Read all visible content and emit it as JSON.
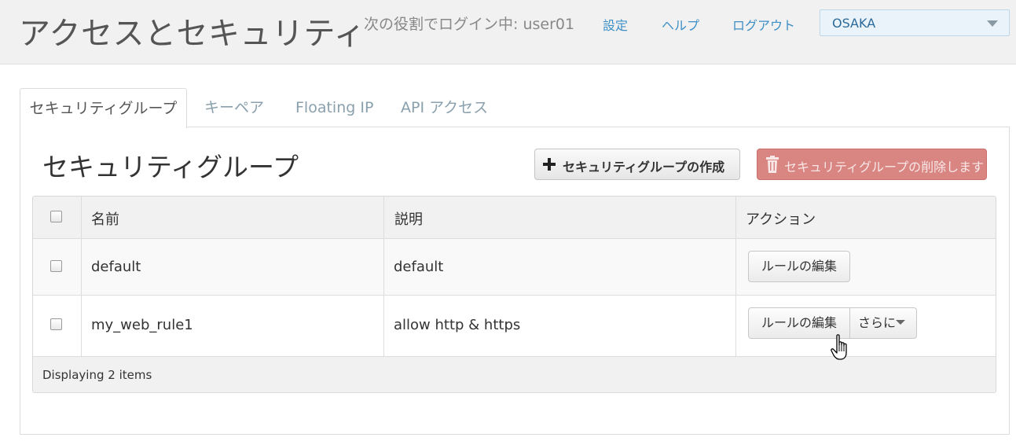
{
  "header": {
    "title": "アクセスとセキュリティ",
    "login_info": "次の役割でログイン中: user01",
    "links": {
      "settings": "設定",
      "help": "ヘルプ",
      "logout": "ログアウト"
    },
    "region": {
      "selected": "OSAKA"
    }
  },
  "tabs": [
    {
      "label": "セキュリティグループ",
      "active": true
    },
    {
      "label": "キーペア"
    },
    {
      "label": "Floating IP"
    },
    {
      "label": "API アクセス"
    }
  ],
  "section": {
    "title": "セキュリティグループ",
    "create_button": "セキュリティグループの作成",
    "delete_button": "セキュリティグループの削除します"
  },
  "table": {
    "columns": [
      "名前",
      "説明",
      "アクション"
    ],
    "rows": [
      {
        "name": "default",
        "description": "default",
        "action": "ルールの編集"
      },
      {
        "name": "my_web_rule1",
        "description": "allow http & https",
        "action": "ルールの編集",
        "more": "さらに"
      }
    ],
    "footer": "Displaying 2 items"
  },
  "colors": {
    "link": "#3d8fc6",
    "danger": "#d98683",
    "header_bg": "#f1f1f1"
  }
}
